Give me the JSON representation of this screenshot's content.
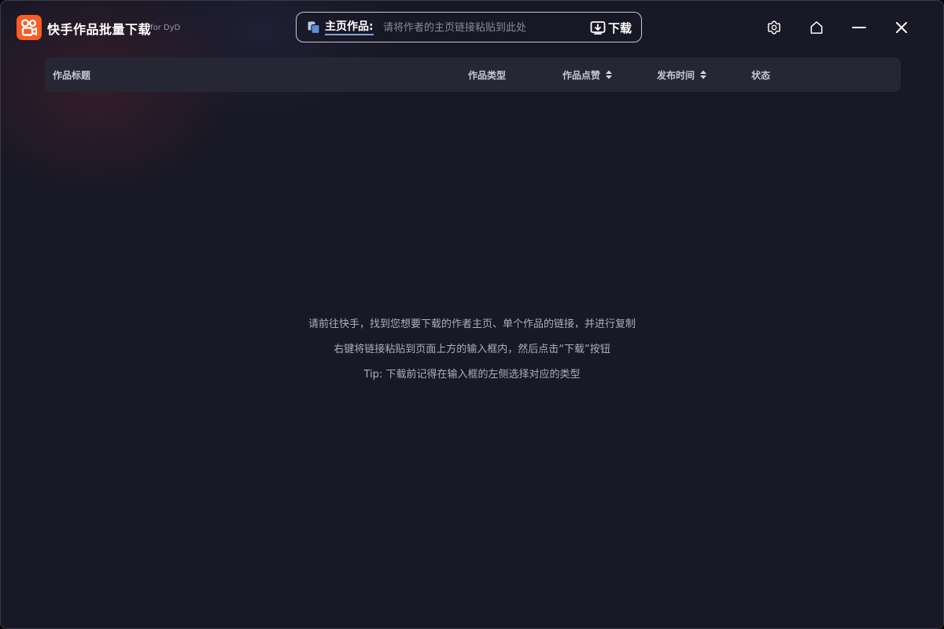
{
  "app": {
    "title": "快手作品批量下载",
    "subtitle": "for DyD",
    "accent_color": "#fe5a22"
  },
  "url_bar": {
    "type_icon": "copy-icon",
    "type_label": "主页作品:",
    "placeholder": "请将作者的主页链接粘贴到此处",
    "value": "",
    "download_icon": "download-icon",
    "download_label": "下载"
  },
  "window_controls": {
    "settings_icon": "gear-icon",
    "home_icon": "home-icon",
    "minimize_icon": "minimize-icon",
    "close_icon": "close-icon"
  },
  "table": {
    "columns": [
      {
        "label": "作品标题",
        "sortable": false
      },
      {
        "label": "作品类型",
        "sortable": false
      },
      {
        "label": "作品点赞",
        "sortable": true
      },
      {
        "label": "发布时间",
        "sortable": true
      },
      {
        "label": "状态",
        "sortable": false
      }
    ],
    "rows": []
  },
  "empty_state": {
    "lines": [
      "请前往快手，找到您想要下载的作者主页、单个作品的链接，并进行复制",
      "右键将链接粘贴到页面上方的输入框内，然后点击“下载”按钮",
      "Tip: 下载前记得在输入框的左侧选择对应的类型"
    ]
  }
}
